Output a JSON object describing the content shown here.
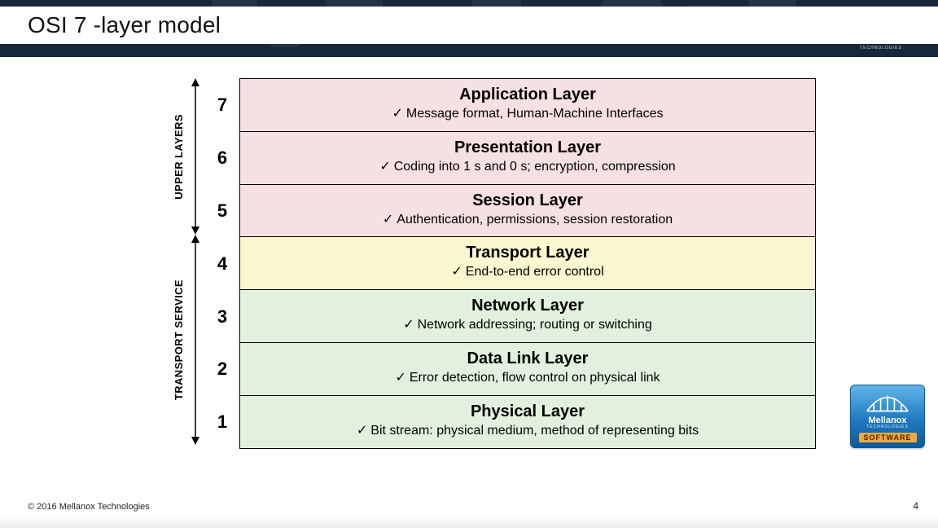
{
  "header": {
    "title": "OSI 7 -layer model",
    "brand": "Mellanox",
    "brand_sub": "TECHNOLOGIES"
  },
  "side_labels": {
    "upper": "UPPER LAYERS",
    "lower": "TRANSPORT SERVICE"
  },
  "layers": [
    {
      "num": "7",
      "title": "Application Layer",
      "desc": "Message format, Human-Machine Interfaces",
      "color": "pink"
    },
    {
      "num": "6",
      "title": "Presentation Layer",
      "desc": "Coding into 1 s and 0 s; encryption, compression",
      "color": "pink"
    },
    {
      "num": "5",
      "title": "Session Layer",
      "desc": "Authentication, permissions, session restoration",
      "color": "pink"
    },
    {
      "num": "4",
      "title": "Transport Layer",
      "desc": "End-to-end error control",
      "color": "yellow"
    },
    {
      "num": "3",
      "title": "Network Layer",
      "desc": "Network addressing; routing or switching",
      "color": "green"
    },
    {
      "num": "2",
      "title": "Data Link Layer",
      "desc": "Error detection, flow control on physical link",
      "color": "green"
    },
    {
      "num": "1",
      "title": "Physical Layer",
      "desc": "Bit stream: physical medium, method of representing bits",
      "color": "green"
    }
  ],
  "footer": {
    "copyright": "© 2016 Mellanox Technologies",
    "page": "4",
    "software_label": "SOFTWARE"
  }
}
